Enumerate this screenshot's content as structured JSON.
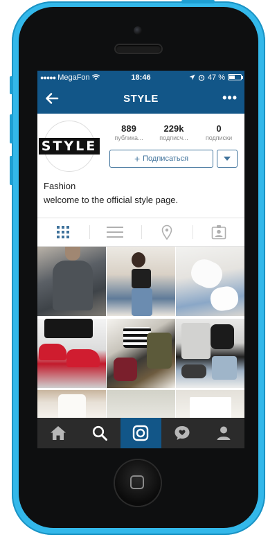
{
  "status_bar": {
    "carrier": "MegaFon",
    "time": "18:46",
    "battery_percent": "47 %",
    "battery_level": 0.47
  },
  "nav": {
    "title": "STYLE",
    "more": "•••"
  },
  "profile": {
    "avatar_logo": "STYLE",
    "stats": [
      {
        "value": "889",
        "label": "публика..."
      },
      {
        "value": "229k",
        "label": "подписч..."
      },
      {
        "value": "0",
        "label": "подписки"
      }
    ],
    "follow_button": "Подписаться",
    "follow_plus": "+",
    "name": "Fashion",
    "bio": "welcome to the official style page."
  },
  "view_tabs": [
    "grid-icon",
    "list-icon",
    "map-pin-icon",
    "tagged-icon"
  ],
  "bottom_bar": [
    "home-icon",
    "search-icon",
    "camera-icon",
    "activity-icon",
    "profile-icon"
  ],
  "colors": {
    "brand": "#125688",
    "phone": "#33b8ea",
    "follow": "#3f729b"
  }
}
